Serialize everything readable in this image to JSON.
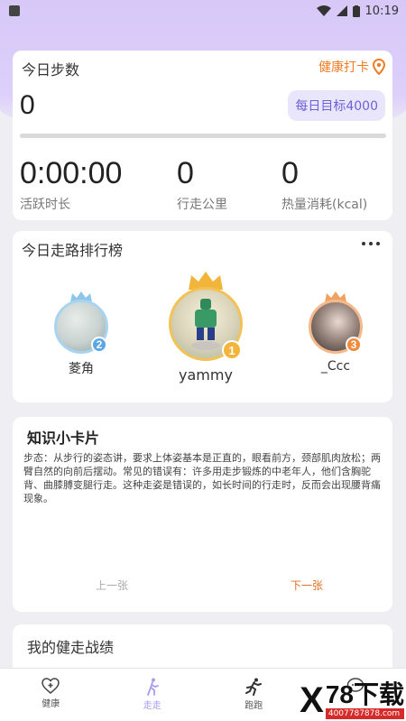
{
  "status_bar": {
    "time": "10:19"
  },
  "steps": {
    "title": "今日步数",
    "checkin_label": "健康打卡",
    "count": "0",
    "goal": "每日目标4000",
    "progress": 0,
    "stats": [
      {
        "value": "0:00:00",
        "label": "活跃时长"
      },
      {
        "value": "0",
        "label": "行走公里"
      },
      {
        "value": "0",
        "label": "热量消耗(kcal)"
      }
    ]
  },
  "ranking": {
    "title": "今日走路排行榜",
    "users": [
      {
        "name": "菱角",
        "rank": "2"
      },
      {
        "name": "yammy",
        "rank": "1"
      },
      {
        "name": "_Ccc",
        "rank": "3"
      }
    ]
  },
  "knowledge": {
    "title": "知识小卡片",
    "text": "步态：从步行的姿态讲，要求上体姿基本是正直的，眼看前方，颈部肌肉放松；两臂自然的向前后摆动。常见的错误有：许多用走步锻炼的中老年人，他们含胸驼背、曲膝膊变腿行走。这种走姿是错误的，如长时间的行走时，反而会出现腰背痛现象。",
    "prev_label": "上一张",
    "next_label": "下一张"
  },
  "records": {
    "title": "我的健走战绩"
  },
  "nav": {
    "items": [
      {
        "label": "健康",
        "icon": "heart-plus-icon"
      },
      {
        "label": "走走",
        "icon": "walking-icon"
      },
      {
        "label": "跑跑",
        "icon": "running-icon"
      },
      {
        "label": "",
        "icon": "chat-icon"
      }
    ]
  },
  "watermark": {
    "big": "78下载",
    "small": "4007787878.com"
  },
  "colors": {
    "accent": "#8b7be8",
    "orange": "#f07c25",
    "gold": "#f2b53a",
    "silver_blue": "#5aa6e6",
    "bronze": "#f08a3c"
  }
}
